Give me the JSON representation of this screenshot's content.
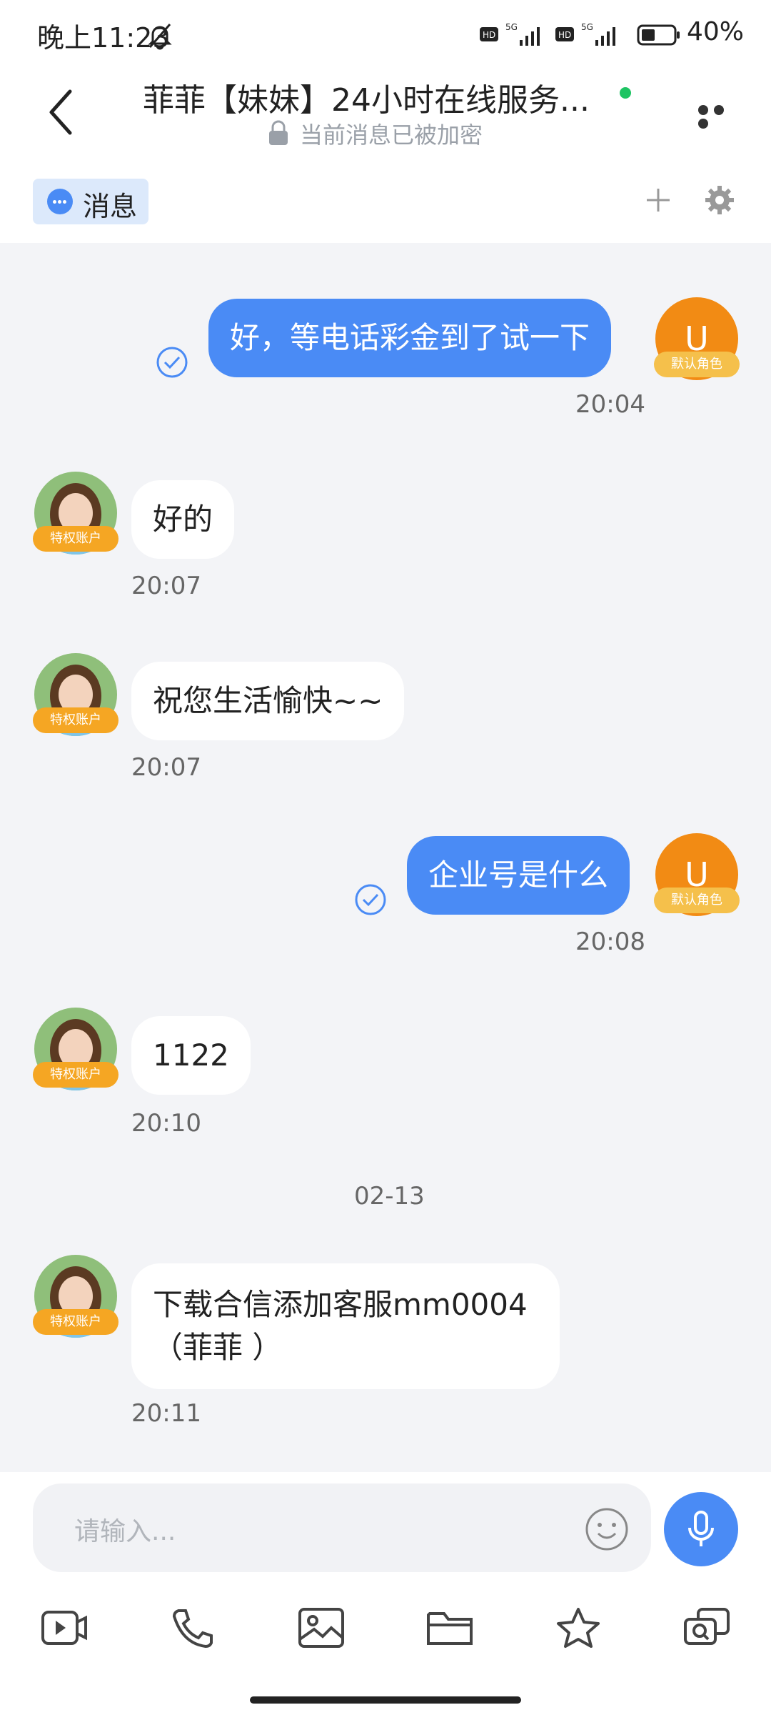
{
  "status_bar": {
    "time": "晚上11:23",
    "battery": "40%"
  },
  "header": {
    "title": "菲菲【妹妹】24小时在线服务...",
    "subtitle": "当前消息已被加密"
  },
  "tab": {
    "label": "消息"
  },
  "messages": [
    {
      "dir": "out",
      "text": "好，等电话彩金到了试一下",
      "time": "20:04",
      "avatar_letter": "U",
      "badge": "默认角色"
    },
    {
      "dir": "in",
      "text": "好的",
      "time": "20:07",
      "badge": "特权账户"
    },
    {
      "dir": "in",
      "text": "祝您生活愉快~~",
      "time": "20:07",
      "badge": "特权账户"
    },
    {
      "dir": "out",
      "text": "企业号是什么",
      "time": "20:08",
      "avatar_letter": "U",
      "badge": "默认角色"
    },
    {
      "dir": "in",
      "text": "1122",
      "time": "20:10",
      "badge": "特权账户"
    },
    {
      "dir": "in",
      "text": "下载合信添加客服mm0004（菲菲 ）",
      "time": "20:11",
      "badge": "特权账户"
    }
  ],
  "date_separator": "02-13",
  "input": {
    "placeholder": "请输入..."
  },
  "colors": {
    "accent": "#4a8bf5",
    "avatar_u": "#f28b14",
    "badge": "#f5a623",
    "online": "#1ec463"
  }
}
